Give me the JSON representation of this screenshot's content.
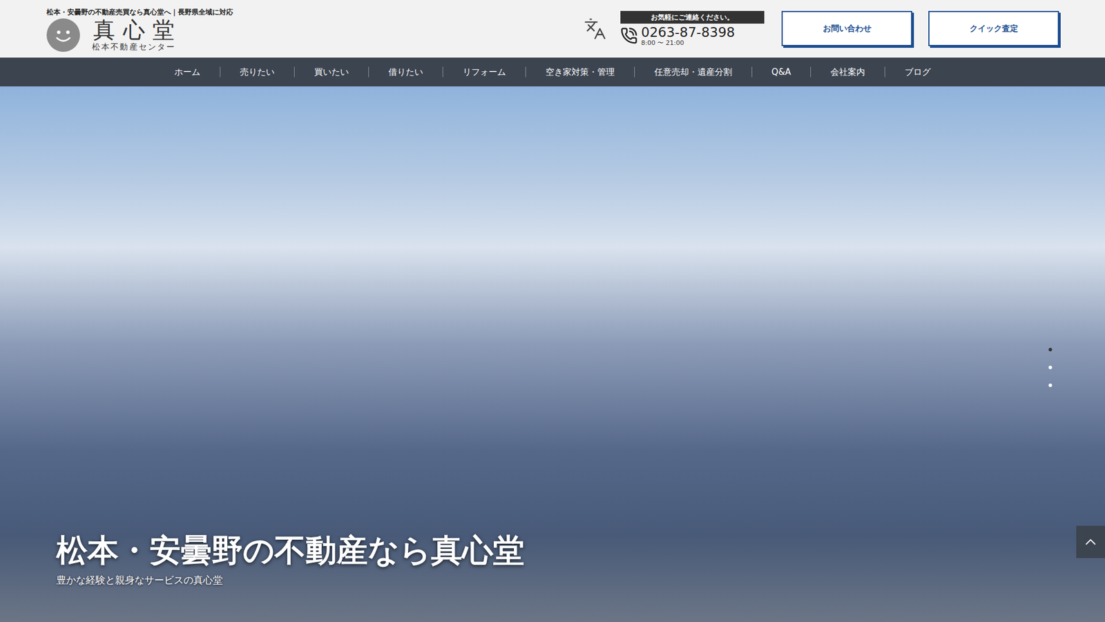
{
  "header": {
    "tagline": "松本・安曇野の不動産売買なら真心堂へ｜長野県全域に対応",
    "logo": {
      "title": "真心堂",
      "subtitle": "松本不動産センター"
    },
    "contact": {
      "label": "お気軽にご連絡ください。",
      "phone": "0263-87-8398",
      "hours": "8:00 〜 21:00"
    },
    "buttons": [
      "お問い合わせ",
      "クイック査定"
    ]
  },
  "nav": {
    "items": [
      "ホーム",
      "売りたい",
      "買いたい",
      "借りたい",
      "リフォーム",
      "空き家対策・管理",
      "任意売却・遺産分割",
      "Q&A",
      "会社案内",
      "ブログ"
    ]
  },
  "hero": {
    "heading": "松本・安曇野の不動産なら真心堂",
    "subheading": "豊かな経験と親身なサービスの真心堂",
    "slides": [
      {
        "selected": true
      },
      {
        "selected": false
      },
      {
        "selected": false
      }
    ]
  }
}
